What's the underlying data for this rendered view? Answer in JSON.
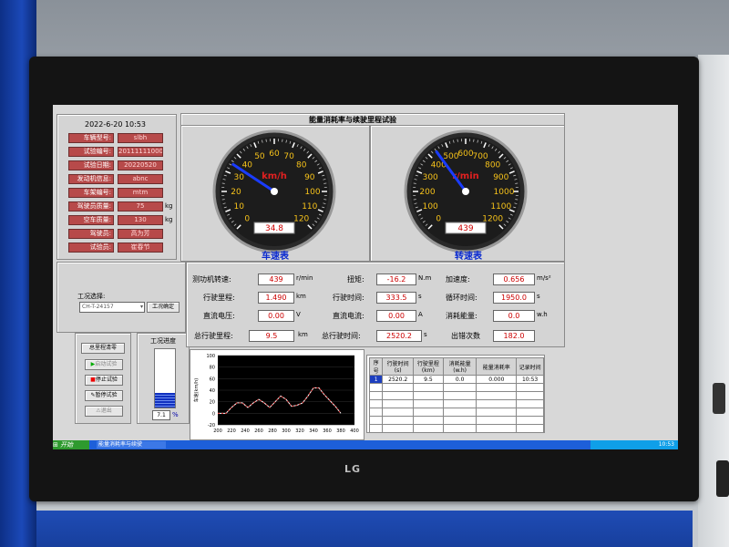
{
  "header": {
    "datetime": "2022-6-20  10:53",
    "title": "能量消耗率与续驶里程试验"
  },
  "vehicle_info": [
    {
      "label": "车辆型号:",
      "value": "slbh",
      "unit": ""
    },
    {
      "label": "试验编号:",
      "value": "20111111000",
      "unit": ""
    },
    {
      "label": "试验日期:",
      "value": "20220520",
      "unit": ""
    },
    {
      "label": "发动机信息:",
      "value": "abnc",
      "unit": ""
    },
    {
      "label": "车架编号:",
      "value": "mtm",
      "unit": ""
    },
    {
      "label": "驾驶员质量:",
      "value": "75",
      "unit": "kg"
    },
    {
      "label": "空车质量:",
      "value": "130",
      "unit": "kg"
    },
    {
      "label": "驾驶员:",
      "value": "高为芳",
      "unit": ""
    },
    {
      "label": "试验员:",
      "value": "崔春节",
      "unit": ""
    }
  ],
  "speed_gauge": {
    "title": "车速表",
    "unit": "km/h",
    "value": 34.8,
    "display": "34.8",
    "min": 0,
    "max": 120,
    "ticks": [
      "0",
      "10",
      "20",
      "30",
      "40",
      "50",
      "60",
      "70",
      "80",
      "90",
      "100",
      "110",
      "120"
    ]
  },
  "rpm_gauge": {
    "title": "转速表",
    "unit": "r/min",
    "value": 439,
    "display": "439",
    "min": 0,
    "max": 1200,
    "ticks": [
      "0",
      "100",
      "200",
      "300",
      "400",
      "500",
      "600",
      "700",
      "800",
      "900",
      "1000",
      "1100",
      "1200"
    ]
  },
  "condition": {
    "label": "工况选择:",
    "selected": "CH-T-24157",
    "confirm_label": "工况确定",
    "speed_label": "工况进度",
    "progress_value": "7.1",
    "progress_unit": "%",
    "progress_fraction": 0.071
  },
  "controls": {
    "reset_label": "总里程清零",
    "start_label": "启动试验",
    "stop_label": "停止试验",
    "pause_label": "暂停试验",
    "exit_label": "退出"
  },
  "readouts": {
    "dyn_speed": {
      "label": "测功机转速:",
      "value": "439",
      "unit": "r/min"
    },
    "torque": {
      "label": "扭矩:",
      "value": "-16.2",
      "unit": "N.m"
    },
    "accel": {
      "label": "加速度:",
      "value": "0.656",
      "unit": "m/s²"
    },
    "distance": {
      "label": "行驶里程:",
      "value": "1.490",
      "unit": "km"
    },
    "time": {
      "label": "行驶时间:",
      "value": "333.5",
      "unit": "s"
    },
    "cycle_time": {
      "label": "循环时间:",
      "value": "1950.0",
      "unit": "s"
    },
    "dc_voltage": {
      "label": "直流电压:",
      "value": "0.00",
      "unit": "V"
    },
    "dc_current": {
      "label": "直流电流:",
      "value": "0.00",
      "unit": "A"
    },
    "energy": {
      "label": "消耗能量:",
      "value": "0.0",
      "unit": "w.h"
    },
    "total_distance": {
      "label": "总行驶里程:",
      "value": "9.5",
      "unit": "km"
    },
    "total_time": {
      "label": "总行驶时间:",
      "value": "2520.2",
      "unit": "s"
    },
    "errors": {
      "label": "出错次数",
      "value": "182.0",
      "unit": ""
    }
  },
  "chart_data": {
    "type": "line",
    "ylabel": "车速(km/h)",
    "x_ticks": [
      "200",
      "220",
      "240",
      "260",
      "280",
      "300",
      "320",
      "340",
      "360",
      "380",
      "400"
    ],
    "y_ticks": [
      "-20",
      "0",
      "20",
      "40",
      "60",
      "80",
      "100"
    ],
    "xlim": [
      200,
      400
    ],
    "ylim": [
      -20,
      100
    ],
    "series": [
      {
        "color": "#ffffff",
        "x": [
          200,
          212,
          220,
          228,
          236,
          244,
          252,
          260,
          268,
          276,
          284,
          292,
          300,
          308,
          316,
          324,
          332,
          340,
          348,
          356,
          364,
          372,
          380
        ],
        "y": [
          0,
          0,
          10,
          18,
          18,
          10,
          18,
          24,
          18,
          10,
          20,
          30,
          24,
          12,
          14,
          18,
          30,
          44,
          44,
          32,
          22,
          12,
          0
        ]
      },
      {
        "color": "#e03030",
        "x": [
          200,
          212,
          220,
          228,
          236,
          244,
          252,
          260,
          268,
          276,
          284,
          292,
          300,
          308,
          316,
          324,
          332,
          340,
          348,
          356,
          364,
          372,
          380
        ],
        "y": [
          0,
          0,
          10,
          18,
          18,
          10,
          18,
          24,
          18,
          10,
          20,
          30,
          24,
          12,
          14,
          18,
          30,
          44,
          44,
          32,
          22,
          12,
          0
        ]
      }
    ]
  },
  "log_table": {
    "headers": [
      "序号",
      "行驶时间(s)",
      "行驶里程(km)",
      "消耗能量(w.h)",
      "能量消耗率",
      "记录时间"
    ],
    "rows": [
      [
        "1",
        "2520.2",
        "9.5",
        "0.0",
        "0.000",
        "10:53"
      ]
    ]
  },
  "taskbar": {
    "start_label": "开始",
    "task_label": "能量消耗率与续驶",
    "clock": "10:53"
  },
  "brand": "LG"
}
